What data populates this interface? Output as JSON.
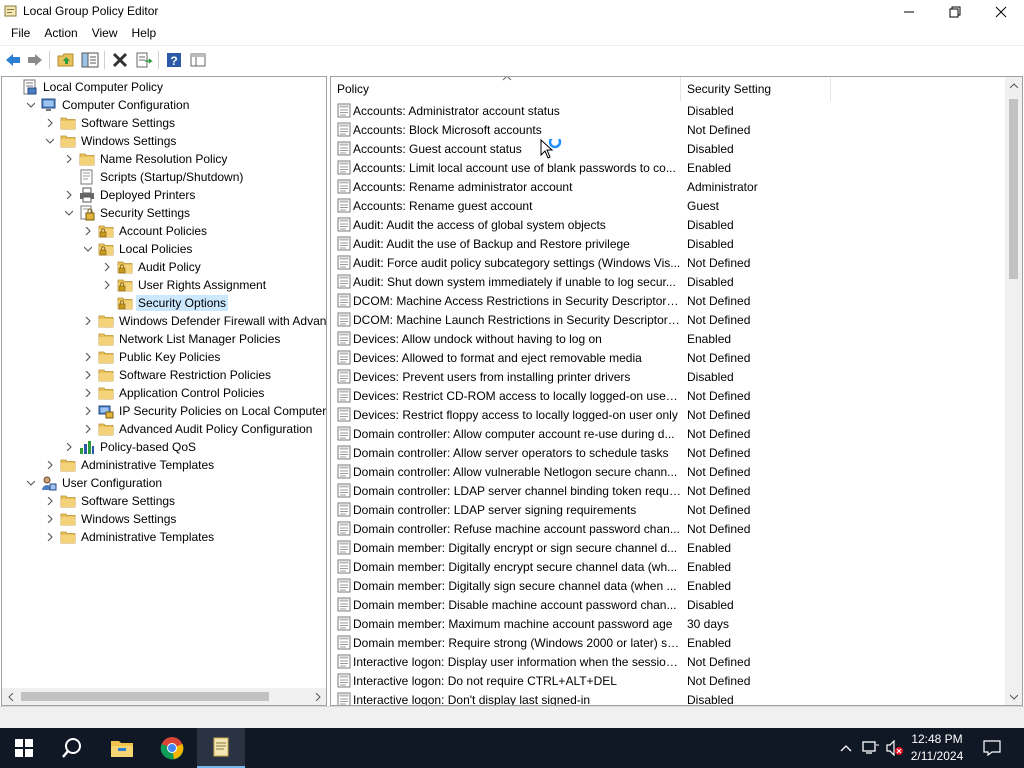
{
  "window": {
    "title": "Local Group Policy Editor"
  },
  "menu": [
    "File",
    "Action",
    "View",
    "Help"
  ],
  "toolbar": {
    "buttons": [
      "back-icon",
      "forward-icon",
      "up-folder-icon",
      "show-hide-tree-icon",
      "delete-icon",
      "export-list-icon",
      "help-icon",
      "properties-icon"
    ]
  },
  "tree": [
    {
      "label": "Local Computer Policy",
      "icon": "policy-computer-icon",
      "expander": "none"
    },
    {
      "label": "Computer Configuration",
      "icon": "computer-icon",
      "expander": "expanded"
    },
    {
      "label": "Software Settings",
      "icon": "folder-icon",
      "expander": "collapsed"
    },
    {
      "label": "Windows Settings",
      "icon": "folder-icon",
      "expander": "expanded"
    },
    {
      "label": "Name Resolution Policy",
      "icon": "folder-icon",
      "expander": "collapsed"
    },
    {
      "label": "Scripts (Startup/Shutdown)",
      "icon": "script-icon",
      "expander": "none"
    },
    {
      "label": "Deployed Printers",
      "icon": "printer-icon",
      "expander": "collapsed"
    },
    {
      "label": "Security Settings",
      "icon": "security-icon",
      "expander": "expanded"
    },
    {
      "label": "Account Policies",
      "icon": "lock-folder-icon",
      "expander": "collapsed"
    },
    {
      "label": "Local Policies",
      "icon": "lock-folder-icon",
      "expander": "expanded"
    },
    {
      "label": "Audit Policy",
      "icon": "lock-folder-icon",
      "expander": "collapsed"
    },
    {
      "label": "User Rights Assignment",
      "icon": "lock-folder-icon",
      "expander": "collapsed"
    },
    {
      "label": "Security Options",
      "icon": "lock-folder-icon",
      "expander": "none",
      "selected": true
    },
    {
      "label": "Windows Defender Firewall with Advanced",
      "icon": "folder-icon",
      "expander": "collapsed"
    },
    {
      "label": "Network List Manager Policies",
      "icon": "folder-icon",
      "expander": "none"
    },
    {
      "label": "Public Key Policies",
      "icon": "folder-icon",
      "expander": "collapsed"
    },
    {
      "label": "Software Restriction Policies",
      "icon": "folder-icon",
      "expander": "collapsed"
    },
    {
      "label": "Application Control Policies",
      "icon": "folder-icon",
      "expander": "collapsed"
    },
    {
      "label": "IP Security Policies on Local Computer",
      "icon": "ip-security-icon",
      "expander": "collapsed"
    },
    {
      "label": "Advanced Audit Policy Configuration",
      "icon": "folder-icon",
      "expander": "collapsed"
    },
    {
      "label": "Policy-based QoS",
      "icon": "chart-icon",
      "expander": "collapsed"
    },
    {
      "label": "Administrative Templates",
      "icon": "folder-icon",
      "expander": "collapsed"
    },
    {
      "label": "User Configuration",
      "icon": "user-icon",
      "expander": "expanded"
    },
    {
      "label": "Software Settings",
      "icon": "folder-icon",
      "expander": "collapsed"
    },
    {
      "label": "Windows Settings",
      "icon": "folder-icon",
      "expander": "collapsed"
    },
    {
      "label": "Administrative Templates",
      "icon": "folder-icon",
      "expander": "collapsed"
    }
  ],
  "list": {
    "columns": [
      "Policy",
      "Security Setting"
    ],
    "rows": [
      {
        "policy": "Accounts: Administrator account status",
        "setting": "Disabled"
      },
      {
        "policy": "Accounts: Block Microsoft accounts",
        "setting": "Not Defined"
      },
      {
        "policy": "Accounts: Guest account status",
        "setting": "Disabled"
      },
      {
        "policy": "Accounts: Limit local account use of blank passwords to co...",
        "setting": "Enabled"
      },
      {
        "policy": "Accounts: Rename administrator account",
        "setting": "Administrator"
      },
      {
        "policy": "Accounts: Rename guest account",
        "setting": "Guest"
      },
      {
        "policy": "Audit: Audit the access of global system objects",
        "setting": "Disabled"
      },
      {
        "policy": "Audit: Audit the use of Backup and Restore privilege",
        "setting": "Disabled"
      },
      {
        "policy": "Audit: Force audit policy subcategory settings (Windows Vis...",
        "setting": "Not Defined"
      },
      {
        "policy": "Audit: Shut down system immediately if unable to log secur...",
        "setting": "Disabled"
      },
      {
        "policy": "DCOM: Machine Access Restrictions in Security Descriptor D...",
        "setting": "Not Defined"
      },
      {
        "policy": "DCOM: Machine Launch Restrictions in Security Descriptor ...",
        "setting": "Not Defined"
      },
      {
        "policy": "Devices: Allow undock without having to log on",
        "setting": "Enabled"
      },
      {
        "policy": "Devices: Allowed to format and eject removable media",
        "setting": "Not Defined"
      },
      {
        "policy": "Devices: Prevent users from installing printer drivers",
        "setting": "Disabled"
      },
      {
        "policy": "Devices: Restrict CD-ROM access to locally logged-on user ...",
        "setting": "Not Defined"
      },
      {
        "policy": "Devices: Restrict floppy access to locally logged-on user only",
        "setting": "Not Defined"
      },
      {
        "policy": "Domain controller: Allow computer account re-use during d...",
        "setting": "Not Defined"
      },
      {
        "policy": "Domain controller: Allow server operators to schedule tasks",
        "setting": "Not Defined"
      },
      {
        "policy": "Domain controller: Allow vulnerable Netlogon secure chann...",
        "setting": "Not Defined"
      },
      {
        "policy": "Domain controller: LDAP server channel binding token requi...",
        "setting": "Not Defined"
      },
      {
        "policy": "Domain controller: LDAP server signing requirements",
        "setting": "Not Defined"
      },
      {
        "policy": "Domain controller: Refuse machine account password chan...",
        "setting": "Not Defined"
      },
      {
        "policy": "Domain member: Digitally encrypt or sign secure channel d...",
        "setting": "Enabled"
      },
      {
        "policy": "Domain member: Digitally encrypt secure channel data (wh...",
        "setting": "Enabled"
      },
      {
        "policy": "Domain member: Digitally sign secure channel data (when ...",
        "setting": "Enabled"
      },
      {
        "policy": "Domain member: Disable machine account password chan...",
        "setting": "Disabled"
      },
      {
        "policy": "Domain member: Maximum machine account password age",
        "setting": "30 days"
      },
      {
        "policy": "Domain member: Require strong (Windows 2000 or later) se...",
        "setting": "Enabled"
      },
      {
        "policy": "Interactive logon: Display user information when the session...",
        "setting": "Not Defined"
      },
      {
        "policy": "Interactive logon: Do not require CTRL+ALT+DEL",
        "setting": "Not Defined"
      },
      {
        "policy": "Interactive logon: Don't display last signed-in",
        "setting": "Disabled"
      }
    ]
  },
  "taskbar": {
    "apps": [
      "start-icon",
      "search-icon",
      "file-explorer-icon",
      "chrome-icon",
      "notepad-icon"
    ],
    "time": "12:48 PM",
    "date": "2/11/2024"
  },
  "colors": {
    "selection": "#cce8ff",
    "taskbar": "#101826",
    "folder": "#e8c15a"
  }
}
